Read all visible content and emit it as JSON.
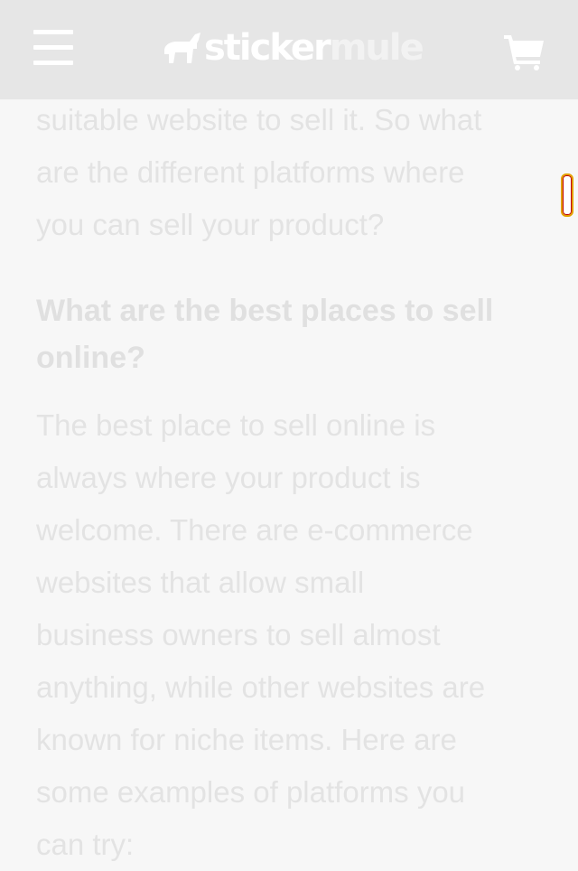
{
  "header": {
    "logo_part1": "sticker",
    "logo_part2": "mule"
  },
  "article": {
    "intro_lines": [
      "suitable website to sell it. So what",
      "are the different platforms where",
      "you can sell your product?"
    ],
    "heading_lines": [
      "What are the best places to sell",
      "online?"
    ],
    "body_lines": [
      "The best place to sell online is",
      "always where your product is",
      "welcome. There are e-commerce",
      "websites that allow small",
      "business owners to sell almost",
      "anything, while other websites are",
      "known for niche items. Here are",
      "some examples of platforms you",
      "can try:"
    ]
  },
  "icons": {
    "menu": "hamburger-menu-icon",
    "logo": "mule-logo-icon",
    "cart": "shopping-cart-icon"
  },
  "colors": {
    "header_bg": "#e6e6e6",
    "page_bg": "#f7f7f7",
    "text": "#e3e3e3",
    "scroll_accent": "#e3a100"
  }
}
